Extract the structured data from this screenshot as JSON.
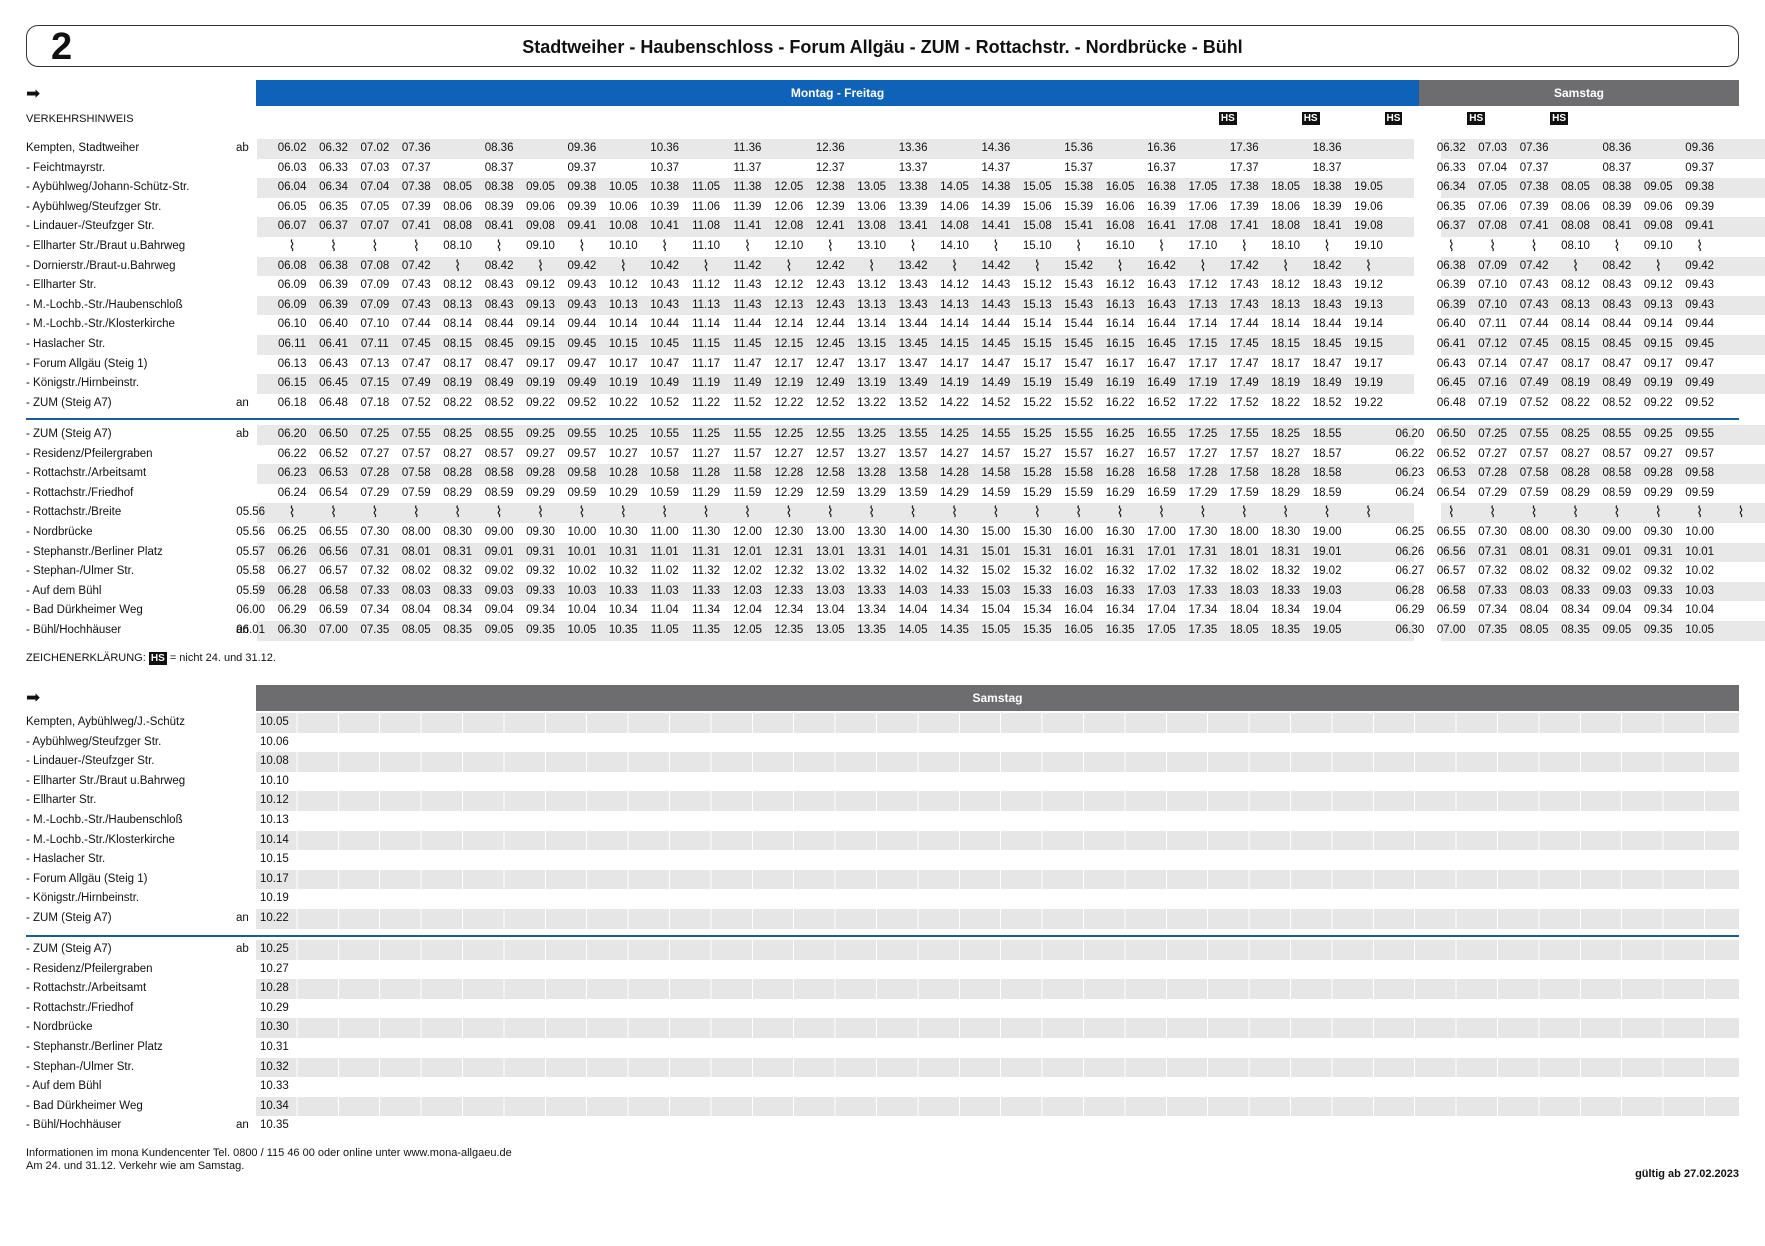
{
  "header": {
    "line": "2",
    "route": "Stadtweiher - Haubenschloss - Forum Allgäu - ZUM - Rottachstr. - Nordbrücke - Bühl"
  },
  "bands": {
    "weekday": "Montag - Freitag",
    "saturday": "Samstag",
    "saturday2": "Samstag"
  },
  "verkehrshinweis": "VERKEHRSHINWEIS",
  "hs_label": "HS",
  "legend": {
    "prefix": "ZEICHENERKLÄRUNG:",
    "label": "HS",
    "text": "= nicht 24. und 31.12."
  },
  "footer": {
    "info1": "Informationen im mona Kundencenter Tel. 0800 / 115 46 00 oder online unter www.mona-allgaeu.de",
    "info2": "Am 24. und 31.12. Verkehr wie am Samstag.",
    "valid": "gültig ab 27.02.2023"
  },
  "hs_columns": [
    23,
    25,
    27,
    29,
    31
  ],
  "table1_stops": [
    [
      "Kempten, Stadtweiher",
      "ab"
    ],
    [
      "- Feichtmayrstr.",
      ""
    ],
    [
      "- Aybühlweg/Johann-Schütz-Str.",
      ""
    ],
    [
      "- Aybühlweg/Steufzger Str.",
      ""
    ],
    [
      "- Lindauer-/Steufzger Str.",
      ""
    ],
    [
      "- Ellharter Str./Braut u.Bahrweg",
      ""
    ],
    [
      "- Dornierstr./Braut-u.Bahrweg",
      ""
    ],
    [
      "- Ellharter Str.",
      ""
    ],
    [
      "- M.-Lochb.-Str./Haubenschloß",
      ""
    ],
    [
      "- M.-Lochb.-Str./Klosterkirche",
      ""
    ],
    [
      "- Haslacher Str.",
      ""
    ],
    [
      "- Forum Allgäu (Steig 1)",
      ""
    ],
    [
      "- Königstr./Hirnbeinstr.",
      ""
    ],
    [
      "- ZUM (Steig A7)",
      "an"
    ]
  ],
  "table1_rows": [
    [
      "",
      "06.02",
      "06.32",
      "07.02",
      "07.36",
      "",
      "08.36",
      "",
      "09.36",
      "",
      "10.36",
      "",
      "11.36",
      "",
      "12.36",
      "",
      "13.36",
      "",
      "14.36",
      "",
      "15.36",
      "",
      "16.36",
      "",
      "17.36",
      "",
      "18.36",
      "",
      "",
      "06.32",
      "07.03",
      "07.36",
      "",
      "08.36",
      "",
      "09.36"
    ],
    [
      "",
      "06.03",
      "06.33",
      "07.03",
      "07.37",
      "",
      "08.37",
      "",
      "09.37",
      "",
      "10.37",
      "",
      "11.37",
      "",
      "12.37",
      "",
      "13.37",
      "",
      "14.37",
      "",
      "15.37",
      "",
      "16.37",
      "",
      "17.37",
      "",
      "18.37",
      "",
      "",
      "06.33",
      "07.04",
      "07.37",
      "",
      "08.37",
      "",
      "09.37"
    ],
    [
      "",
      "06.04",
      "06.34",
      "07.04",
      "07.38",
      "08.05",
      "08.38",
      "09.05",
      "09.38",
      "10.05",
      "10.38",
      "11.05",
      "11.38",
      "12.05",
      "12.38",
      "13.05",
      "13.38",
      "14.05",
      "14.38",
      "15.05",
      "15.38",
      "16.05",
      "16.38",
      "17.05",
      "17.38",
      "18.05",
      "18.38",
      "19.05",
      "",
      "06.34",
      "07.05",
      "07.38",
      "08.05",
      "08.38",
      "09.05",
      "09.38"
    ],
    [
      "",
      "06.05",
      "06.35",
      "07.05",
      "07.39",
      "08.06",
      "08.39",
      "09.06",
      "09.39",
      "10.06",
      "10.39",
      "11.06",
      "11.39",
      "12.06",
      "12.39",
      "13.06",
      "13.39",
      "14.06",
      "14.39",
      "15.06",
      "15.39",
      "16.06",
      "16.39",
      "17.06",
      "17.39",
      "18.06",
      "18.39",
      "19.06",
      "",
      "06.35",
      "07.06",
      "07.39",
      "08.06",
      "08.39",
      "09.06",
      "09.39"
    ],
    [
      "",
      "06.07",
      "06.37",
      "07.07",
      "07.41",
      "08.08",
      "08.41",
      "09.08",
      "09.41",
      "10.08",
      "10.41",
      "11.08",
      "11.41",
      "12.08",
      "12.41",
      "13.08",
      "13.41",
      "14.08",
      "14.41",
      "15.08",
      "15.41",
      "16.08",
      "16.41",
      "17.08",
      "17.41",
      "18.08",
      "18.41",
      "19.08",
      "",
      "06.37",
      "07.08",
      "07.41",
      "08.08",
      "08.41",
      "09.08",
      "09.41"
    ],
    [
      "",
      "~",
      "~",
      "~",
      "~",
      "08.10",
      "~",
      "09.10",
      "~",
      "10.10",
      "~",
      "11.10",
      "~",
      "12.10",
      "~",
      "13.10",
      "~",
      "14.10",
      "~",
      "15.10",
      "~",
      "16.10",
      "~",
      "17.10",
      "~",
      "18.10",
      "~",
      "19.10",
      "",
      "~",
      "~",
      "~",
      "08.10",
      "~",
      "09.10",
      "~"
    ],
    [
      "",
      "06.08",
      "06.38",
      "07.08",
      "07.42",
      "~",
      "08.42",
      "~",
      "09.42",
      "~",
      "10.42",
      "~",
      "11.42",
      "~",
      "12.42",
      "~",
      "13.42",
      "~",
      "14.42",
      "~",
      "15.42",
      "~",
      "16.42",
      "~",
      "17.42",
      "~",
      "18.42",
      "~",
      "",
      "06.38",
      "07.09",
      "07.42",
      "~",
      "08.42",
      "~",
      "09.42"
    ],
    [
      "",
      "06.09",
      "06.39",
      "07.09",
      "07.43",
      "08.12",
      "08.43",
      "09.12",
      "09.43",
      "10.12",
      "10.43",
      "11.12",
      "11.43",
      "12.12",
      "12.43",
      "13.12",
      "13.43",
      "14.12",
      "14.43",
      "15.12",
      "15.43",
      "16.12",
      "16.43",
      "17.12",
      "17.43",
      "18.12",
      "18.43",
      "19.12",
      "",
      "06.39",
      "07.10",
      "07.43",
      "08.12",
      "08.43",
      "09.12",
      "09.43"
    ],
    [
      "",
      "06.09",
      "06.39",
      "07.09",
      "07.43",
      "08.13",
      "08.43",
      "09.13",
      "09.43",
      "10.13",
      "10.43",
      "11.13",
      "11.43",
      "12.13",
      "12.43",
      "13.13",
      "13.43",
      "14.13",
      "14.43",
      "15.13",
      "15.43",
      "16.13",
      "16.43",
      "17.13",
      "17.43",
      "18.13",
      "18.43",
      "19.13",
      "",
      "06.39",
      "07.10",
      "07.43",
      "08.13",
      "08.43",
      "09.13",
      "09.43"
    ],
    [
      "",
      "06.10",
      "06.40",
      "07.10",
      "07.44",
      "08.14",
      "08.44",
      "09.14",
      "09.44",
      "10.14",
      "10.44",
      "11.14",
      "11.44",
      "12.14",
      "12.44",
      "13.14",
      "13.44",
      "14.14",
      "14.44",
      "15.14",
      "15.44",
      "16.14",
      "16.44",
      "17.14",
      "17.44",
      "18.14",
      "18.44",
      "19.14",
      "",
      "06.40",
      "07.11",
      "07.44",
      "08.14",
      "08.44",
      "09.14",
      "09.44"
    ],
    [
      "",
      "06.11",
      "06.41",
      "07.11",
      "07.45",
      "08.15",
      "08.45",
      "09.15",
      "09.45",
      "10.15",
      "10.45",
      "11.15",
      "11.45",
      "12.15",
      "12.45",
      "13.15",
      "13.45",
      "14.15",
      "14.45",
      "15.15",
      "15.45",
      "16.15",
      "16.45",
      "17.15",
      "17.45",
      "18.15",
      "18.45",
      "19.15",
      "",
      "06.41",
      "07.12",
      "07.45",
      "08.15",
      "08.45",
      "09.15",
      "09.45"
    ],
    [
      "",
      "06.13",
      "06.43",
      "07.13",
      "07.47",
      "08.17",
      "08.47",
      "09.17",
      "09.47",
      "10.17",
      "10.47",
      "11.17",
      "11.47",
      "12.17",
      "12.47",
      "13.17",
      "13.47",
      "14.17",
      "14.47",
      "15.17",
      "15.47",
      "16.17",
      "16.47",
      "17.17",
      "17.47",
      "18.17",
      "18.47",
      "19.17",
      "",
      "06.43",
      "07.14",
      "07.47",
      "08.17",
      "08.47",
      "09.17",
      "09.47"
    ],
    [
      "",
      "06.15",
      "06.45",
      "07.15",
      "07.49",
      "08.19",
      "08.49",
      "09.19",
      "09.49",
      "10.19",
      "10.49",
      "11.19",
      "11.49",
      "12.19",
      "12.49",
      "13.19",
      "13.49",
      "14.19",
      "14.49",
      "15.19",
      "15.49",
      "16.19",
      "16.49",
      "17.19",
      "17.49",
      "18.19",
      "18.49",
      "19.19",
      "",
      "06.45",
      "07.16",
      "07.49",
      "08.19",
      "08.49",
      "09.19",
      "09.49"
    ],
    [
      "",
      "06.18",
      "06.48",
      "07.18",
      "07.52",
      "08.22",
      "08.52",
      "09.22",
      "09.52",
      "10.22",
      "10.52",
      "11.22",
      "11.52",
      "12.22",
      "12.52",
      "13.22",
      "13.52",
      "14.22",
      "14.52",
      "15.22",
      "15.52",
      "16.22",
      "16.52",
      "17.22",
      "17.52",
      "18.22",
      "18.52",
      "19.22",
      "",
      "06.48",
      "07.19",
      "07.52",
      "08.22",
      "08.52",
      "09.22",
      "09.52"
    ]
  ],
  "table2_stops": [
    [
      "- ZUM (Steig A7)",
      "ab"
    ],
    [
      "- Residenz/Pfeilergraben",
      ""
    ],
    [
      "- Rottachstr./Arbeitsamt",
      ""
    ],
    [
      "- Rottachstr./Friedhof",
      ""
    ],
    [
      "- Rottachstr./Breite",
      ""
    ],
    [
      "- Nordbrücke",
      ""
    ],
    [
      "- Stephanstr./Berliner Platz",
      ""
    ],
    [
      "- Stephan-/Ulmer Str.",
      ""
    ],
    [
      "- Auf dem Bühl",
      ""
    ],
    [
      "- Bad Dürkheimer Weg",
      ""
    ],
    [
      "- Bühl/Hochhäuser",
      "an"
    ]
  ],
  "table2_rows": [
    [
      "",
      "06.20",
      "06.50",
      "07.25",
      "07.55",
      "08.25",
      "08.55",
      "09.25",
      "09.55",
      "10.25",
      "10.55",
      "11.25",
      "11.55",
      "12.25",
      "12.55",
      "13.25",
      "13.55",
      "14.25",
      "14.55",
      "15.25",
      "15.55",
      "16.25",
      "16.55",
      "17.25",
      "17.55",
      "18.25",
      "18.55",
      "",
      "06.20",
      "06.50",
      "07.25",
      "07.55",
      "08.25",
      "08.55",
      "09.25",
      "09.55"
    ],
    [
      "",
      "06.22",
      "06.52",
      "07.27",
      "07.57",
      "08.27",
      "08.57",
      "09.27",
      "09.57",
      "10.27",
      "10.57",
      "11.27",
      "11.57",
      "12.27",
      "12.57",
      "13.27",
      "13.57",
      "14.27",
      "14.57",
      "15.27",
      "15.57",
      "16.27",
      "16.57",
      "17.27",
      "17.57",
      "18.27",
      "18.57",
      "",
      "06.22",
      "06.52",
      "07.27",
      "07.57",
      "08.27",
      "08.57",
      "09.27",
      "09.57"
    ],
    [
      "",
      "06.23",
      "06.53",
      "07.28",
      "07.58",
      "08.28",
      "08.58",
      "09.28",
      "09.58",
      "10.28",
      "10.58",
      "11.28",
      "11.58",
      "12.28",
      "12.58",
      "13.28",
      "13.58",
      "14.28",
      "14.58",
      "15.28",
      "15.58",
      "16.28",
      "16.58",
      "17.28",
      "17.58",
      "18.28",
      "18.58",
      "",
      "06.23",
      "06.53",
      "07.28",
      "07.58",
      "08.28",
      "08.58",
      "09.28",
      "09.58"
    ],
    [
      "",
      "06.24",
      "06.54",
      "07.29",
      "07.59",
      "08.29",
      "08.59",
      "09.29",
      "09.59",
      "10.29",
      "10.59",
      "11.29",
      "11.59",
      "12.29",
      "12.59",
      "13.29",
      "13.59",
      "14.29",
      "14.59",
      "15.29",
      "15.59",
      "16.29",
      "16.59",
      "17.29",
      "17.59",
      "18.29",
      "18.59",
      "",
      "06.24",
      "06.54",
      "07.29",
      "07.59",
      "08.29",
      "08.59",
      "09.29",
      "09.59"
    ],
    [
      "05.56",
      "~",
      "~",
      "~",
      "~",
      "~",
      "~",
      "~",
      "~",
      "~",
      "~",
      "~",
      "~",
      "~",
      "~",
      "~",
      "~",
      "~",
      "~",
      "~",
      "~",
      "~",
      "~",
      "~",
      "~",
      "~",
      "~",
      "~",
      "",
      "~",
      "~",
      "~",
      "~",
      "~",
      "~",
      "~",
      "~"
    ],
    [
      "05.56",
      "06.25",
      "06.55",
      "07.30",
      "08.00",
      "08.30",
      "09.00",
      "09.30",
      "10.00",
      "10.30",
      "11.00",
      "11.30",
      "12.00",
      "12.30",
      "13.00",
      "13.30",
      "14.00",
      "14.30",
      "15.00",
      "15.30",
      "16.00",
      "16.30",
      "17.00",
      "17.30",
      "18.00",
      "18.30",
      "19.00",
      "",
      "06.25",
      "06.55",
      "07.30",
      "08.00",
      "08.30",
      "09.00",
      "09.30",
      "10.00"
    ],
    [
      "05.57",
      "06.26",
      "06.56",
      "07.31",
      "08.01",
      "08.31",
      "09.01",
      "09.31",
      "10.01",
      "10.31",
      "11.01",
      "11.31",
      "12.01",
      "12.31",
      "13.01",
      "13.31",
      "14.01",
      "14.31",
      "15.01",
      "15.31",
      "16.01",
      "16.31",
      "17.01",
      "17.31",
      "18.01",
      "18.31",
      "19.01",
      "",
      "06.26",
      "06.56",
      "07.31",
      "08.01",
      "08.31",
      "09.01",
      "09.31",
      "10.01"
    ],
    [
      "05.58",
      "06.27",
      "06.57",
      "07.32",
      "08.02",
      "08.32",
      "09.02",
      "09.32",
      "10.02",
      "10.32",
      "11.02",
      "11.32",
      "12.02",
      "12.32",
      "13.02",
      "13.32",
      "14.02",
      "14.32",
      "15.02",
      "15.32",
      "16.02",
      "16.32",
      "17.02",
      "17.32",
      "18.02",
      "18.32",
      "19.02",
      "",
      "06.27",
      "06.57",
      "07.32",
      "08.02",
      "08.32",
      "09.02",
      "09.32",
      "10.02"
    ],
    [
      "05.59",
      "06.28",
      "06.58",
      "07.33",
      "08.03",
      "08.33",
      "09.03",
      "09.33",
      "10.03",
      "10.33",
      "11.03",
      "11.33",
      "12.03",
      "12.33",
      "13.03",
      "13.33",
      "14.03",
      "14.33",
      "15.03",
      "15.33",
      "16.03",
      "16.33",
      "17.03",
      "17.33",
      "18.03",
      "18.33",
      "19.03",
      "",
      "06.28",
      "06.58",
      "07.33",
      "08.03",
      "08.33",
      "09.03",
      "09.33",
      "10.03"
    ],
    [
      "06.00",
      "06.29",
      "06.59",
      "07.34",
      "08.04",
      "08.34",
      "09.04",
      "09.34",
      "10.04",
      "10.34",
      "11.04",
      "11.34",
      "12.04",
      "12.34",
      "13.04",
      "13.34",
      "14.04",
      "14.34",
      "15.04",
      "15.34",
      "16.04",
      "16.34",
      "17.04",
      "17.34",
      "18.04",
      "18.34",
      "19.04",
      "",
      "06.29",
      "06.59",
      "07.34",
      "08.04",
      "08.34",
      "09.04",
      "09.34",
      "10.04"
    ],
    [
      "06.01",
      "06.30",
      "07.00",
      "07.35",
      "08.05",
      "08.35",
      "09.05",
      "09.35",
      "10.05",
      "10.35",
      "11.05",
      "11.35",
      "12.05",
      "12.35",
      "13.05",
      "13.35",
      "14.05",
      "14.35",
      "15.05",
      "15.35",
      "16.05",
      "16.35",
      "17.05",
      "17.35",
      "18.05",
      "18.35",
      "19.05",
      "",
      "06.30",
      "07.00",
      "07.35",
      "08.05",
      "08.35",
      "09.05",
      "09.35",
      "10.05"
    ]
  ],
  "table3_stops": [
    [
      "Kempten, Aybühlweg/J.-Schütz",
      ""
    ],
    [
      "- Aybühlweg/Steufzger Str.",
      ""
    ],
    [
      "- Lindauer-/Steufzger Str.",
      ""
    ],
    [
      "- Ellharter Str./Braut u.Bahrweg",
      ""
    ],
    [
      "- Ellharter Str.",
      ""
    ],
    [
      "- M.-Lochb.-Str./Haubenschloß",
      ""
    ],
    [
      "- M.-Lochb.-Str./Klosterkirche",
      ""
    ],
    [
      "- Haslacher Str.",
      ""
    ],
    [
      "- Forum Allgäu (Steig 1)",
      ""
    ],
    [
      "- Königstr./Hirnbeinstr.",
      ""
    ],
    [
      "- ZUM (Steig A7)",
      "an"
    ]
  ],
  "table3_times": [
    "10.05",
    "10.06",
    "10.08",
    "10.10",
    "10.12",
    "10.13",
    "10.14",
    "10.15",
    "10.17",
    "10.19",
    "10.22"
  ],
  "table4_stops": [
    [
      "- ZUM (Steig A7)",
      "ab"
    ],
    [
      "- Residenz/Pfeilergraben",
      ""
    ],
    [
      "- Rottachstr./Arbeitsamt",
      ""
    ],
    [
      "- Rottachstr./Friedhof",
      ""
    ],
    [
      "- Nordbrücke",
      ""
    ],
    [
      "- Stephanstr./Berliner Platz",
      ""
    ],
    [
      "- Stephan-/Ulmer Str.",
      ""
    ],
    [
      "- Auf dem Bühl",
      ""
    ],
    [
      "- Bad Dürkheimer Weg",
      ""
    ],
    [
      "- Bühl/Hochhäuser",
      "an"
    ]
  ],
  "table4_times": [
    "10.25",
    "10.27",
    "10.28",
    "10.29",
    "10.30",
    "10.31",
    "10.32",
    "10.33",
    "10.34",
    "10.35"
  ]
}
